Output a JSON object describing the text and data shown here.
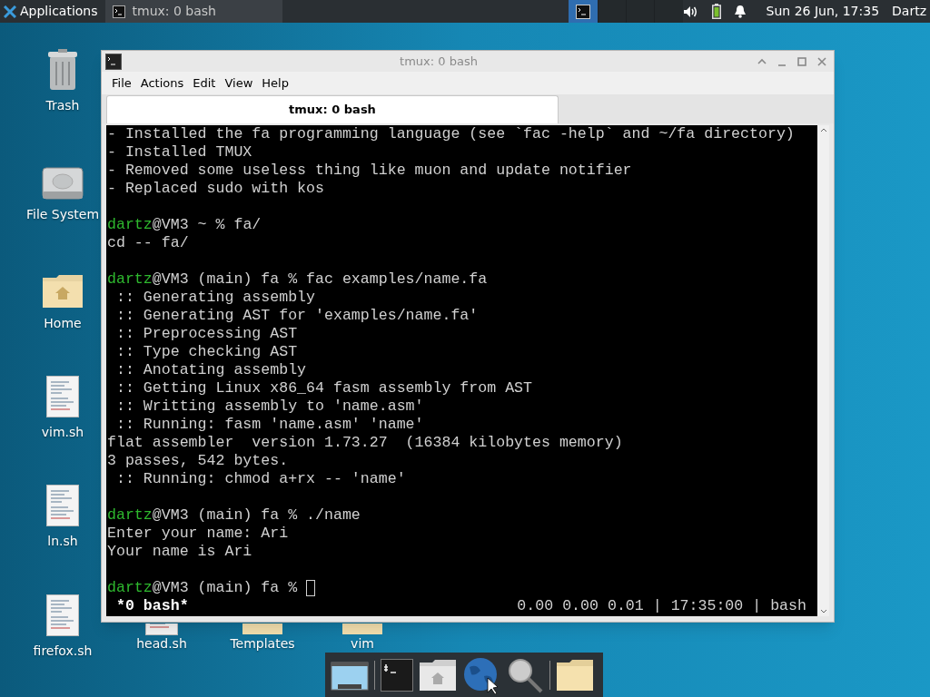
{
  "panel": {
    "applications": "Applications",
    "tasks": [
      {
        "label": "tmux: 0 bash",
        "selected": true
      }
    ],
    "workspaces": [
      {
        "selected": true
      },
      {
        "selected": false
      },
      {
        "selected": false
      },
      {
        "selected": false
      }
    ],
    "clock": "Sun 26 Jun, 17:35",
    "user": "Dartz"
  },
  "desktop_icons": [
    {
      "kind": "trash",
      "label": "Trash"
    },
    {
      "kind": "drive",
      "label": "File System"
    },
    {
      "kind": "home",
      "label": "Home"
    },
    {
      "kind": "script",
      "label": "vim.sh"
    },
    {
      "kind": "script",
      "label": "ln.sh"
    },
    {
      "kind": "script",
      "label": "firefox.sh"
    },
    {
      "kind": "script",
      "label": "head.sh"
    },
    {
      "kind": "folder",
      "label": "Templates"
    },
    {
      "kind": "folder",
      "label": "vim"
    }
  ],
  "window": {
    "title": "tmux: 0 bash",
    "menu": [
      "File",
      "Actions",
      "Edit",
      "View",
      "Help"
    ],
    "tabs": [
      {
        "label": "tmux: 0 bash",
        "selected": true
      }
    ],
    "terminal": {
      "blocks": [
        [
          {
            "text": "- Installed the fa programming language (see `fac -help` and ~/fa directory)"
          },
          {
            "text": "- Installed TMUX"
          },
          {
            "text": "- Removed some useless thing like muon and update notifier"
          },
          {
            "text": "- Replaced sudo with kos"
          }
        ],
        [
          {
            "user": "dartz",
            "text": "@VM3 ~ % fa/"
          },
          {
            "text": "cd -- fa/"
          }
        ],
        [
          {
            "user": "dartz",
            "text": "@VM3 (main) fa % fac examples/name.fa"
          },
          {
            "text": " :: Generating assembly"
          },
          {
            "text": " :: Generating AST for 'examples/name.fa'"
          },
          {
            "text": " :: Preprocessing AST"
          },
          {
            "text": " :: Type checking AST"
          },
          {
            "text": " :: Anotating assembly"
          },
          {
            "text": " :: Getting Linux x86_64 fasm assembly from AST"
          },
          {
            "text": " :: Writting assembly to 'name.asm'"
          },
          {
            "text": " :: Running: fasm 'name.asm' 'name'"
          },
          {
            "text": "flat assembler  version 1.73.27  (16384 kilobytes memory)"
          },
          {
            "text": "3 passes, 542 bytes."
          },
          {
            "text": " :: Running: chmod a+rx -- 'name'"
          }
        ],
        [
          {
            "user": "dartz",
            "text": "@VM3 (main) fa % ./name"
          },
          {
            "text": "Enter your name: Ari"
          },
          {
            "text": "Your name is Ari"
          }
        ],
        [
          {
            "user": "dartz",
            "text": "@VM3 (main) fa % ",
            "cursor": true
          }
        ]
      ],
      "status_left": "*0 bash*",
      "status_right": "0.00 0.00 0.01 | 17:35:00 | bash"
    }
  }
}
